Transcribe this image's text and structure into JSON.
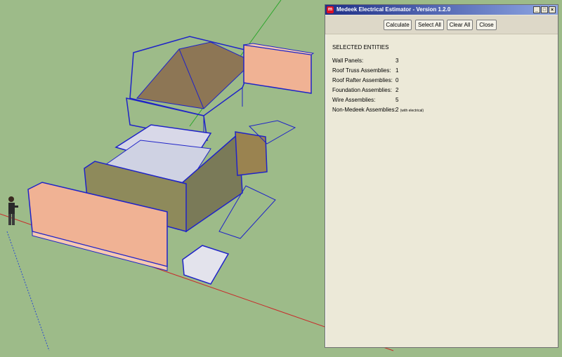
{
  "window": {
    "title": "Medeek Electrical Estimator - Version 1.2.0",
    "controls": {
      "minimize": "_",
      "maximize": "□",
      "close": "×"
    }
  },
  "toolbar": {
    "calculate": "Calculate",
    "select_all": "Select All",
    "clear_all": "Clear All",
    "close": "Close"
  },
  "entities": {
    "heading": "SELECTED ENTITIES",
    "items": [
      {
        "label": "Wall Panels:",
        "value": "3",
        "note": ""
      },
      {
        "label": "Roof Truss Assemblies:",
        "value": "1",
        "note": ""
      },
      {
        "label": "Roof Rafter Assemblies:",
        "value": "0",
        "note": ""
      },
      {
        "label": "Foundation Assemblies:",
        "value": "2",
        "note": ""
      },
      {
        "label": "Wire Assemblies:",
        "value": "5",
        "note": ""
      },
      {
        "label": "Non-Medeek Assemblies:",
        "value": "2",
        "note": "(with electrical)"
      }
    ]
  },
  "colors": {
    "viewport_bg": "#9dbb89",
    "model_outline": "#1f23c8",
    "panel_fill": "#f0b294",
    "titlebar": "#1e2f86"
  }
}
